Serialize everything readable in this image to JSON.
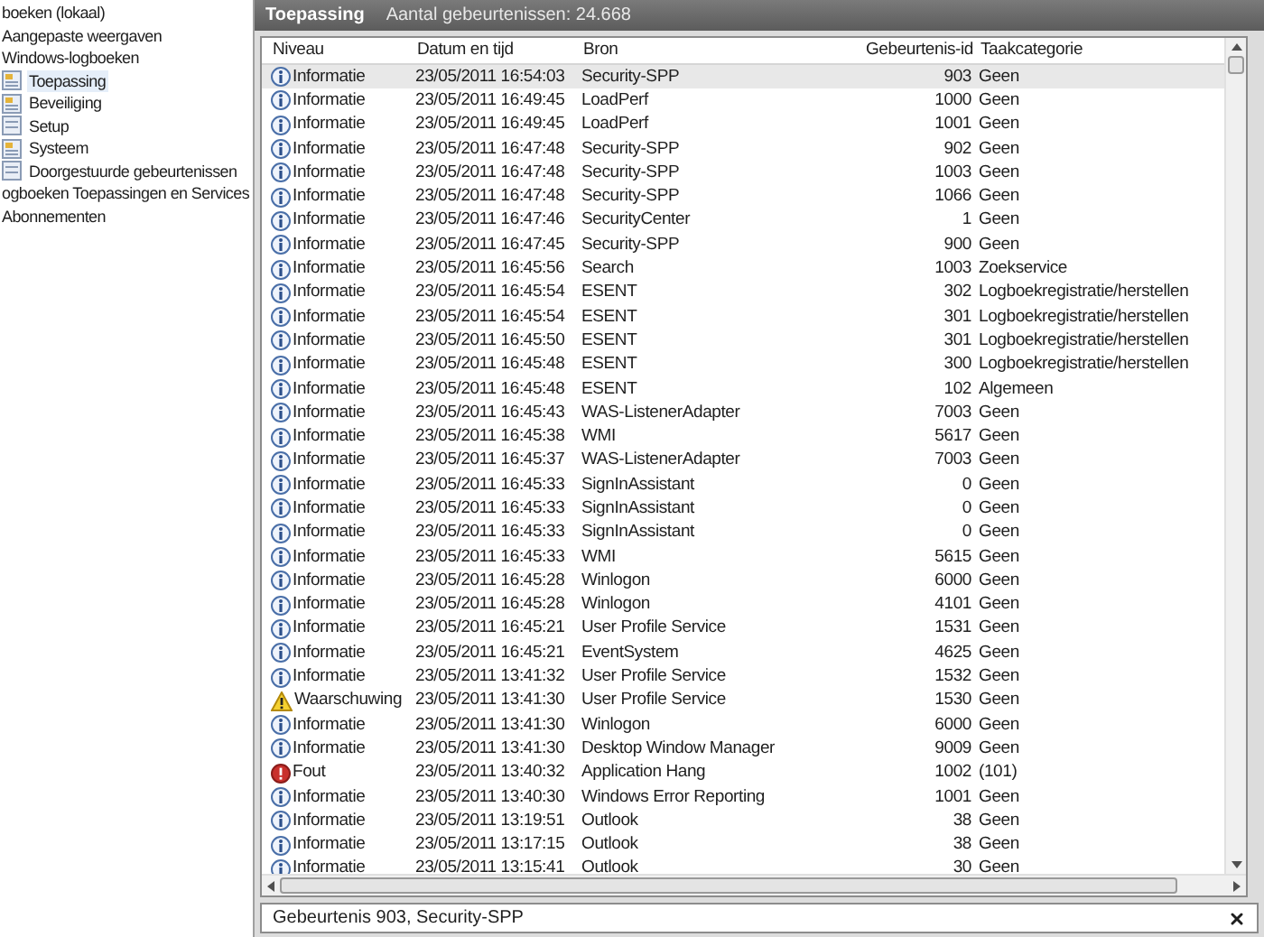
{
  "tree": [
    {
      "label": "boeken (lokaal)",
      "selected": false
    },
    {
      "label": "Aangepaste weergaven",
      "selected": false
    },
    {
      "label": "Windows-logboeken",
      "selected": false,
      "children": [
        {
          "label": "Toepassing",
          "selected": true,
          "kind": "log"
        },
        {
          "label": "Beveiliging",
          "selected": false,
          "kind": "log"
        },
        {
          "label": "Setup",
          "selected": false,
          "kind": "plain"
        },
        {
          "label": "Systeem",
          "selected": false,
          "kind": "log"
        },
        {
          "label": "Doorgestuurde gebeurtenissen",
          "selected": false,
          "kind": "plain"
        }
      ]
    },
    {
      "label": "ogboeken Toepassingen en Services",
      "selected": false
    },
    {
      "label": "Abonnementen",
      "selected": false
    }
  ],
  "panel": {
    "title": "Toepassing",
    "count": "Aantal gebeurtenissen: 24.668"
  },
  "table": {
    "columns": [
      "Niveau",
      "Datum en tijd",
      "Bron",
      "Gebeurtenis-id",
      "Taakcategorie"
    ],
    "rows": [
      {
        "kind": "info",
        "level": "Informatie",
        "date": "23/05/2011 16:54:03",
        "source": "Security-SPP",
        "id": "903",
        "category": "Geen",
        "selected": true
      },
      {
        "kind": "info",
        "level": "Informatie",
        "date": "23/05/2011 16:49:45",
        "source": "LoadPerf",
        "id": "1000",
        "category": "Geen",
        "selected": false
      },
      {
        "kind": "info",
        "level": "Informatie",
        "date": "23/05/2011 16:49:45",
        "source": "LoadPerf",
        "id": "1001",
        "category": "Geen",
        "selected": false
      },
      {
        "kind": "info",
        "level": "Informatie",
        "date": "23/05/2011 16:47:48",
        "source": "Security-SPP",
        "id": "902",
        "category": "Geen",
        "selected": false
      },
      {
        "kind": "info",
        "level": "Informatie",
        "date": "23/05/2011 16:47:48",
        "source": "Security-SPP",
        "id": "1003",
        "category": "Geen",
        "selected": false
      },
      {
        "kind": "info",
        "level": "Informatie",
        "date": "23/05/2011 16:47:48",
        "source": "Security-SPP",
        "id": "1066",
        "category": "Geen",
        "selected": false
      },
      {
        "kind": "info",
        "level": "Informatie",
        "date": "23/05/2011 16:47:46",
        "source": "SecurityCenter",
        "id": "1",
        "category": "Geen",
        "selected": false
      },
      {
        "kind": "info",
        "level": "Informatie",
        "date": "23/05/2011 16:47:45",
        "source": "Security-SPP",
        "id": "900",
        "category": "Geen",
        "selected": false
      },
      {
        "kind": "info",
        "level": "Informatie",
        "date": "23/05/2011 16:45:56",
        "source": "Search",
        "id": "1003",
        "category": "Zoekservice",
        "selected": false
      },
      {
        "kind": "info",
        "level": "Informatie",
        "date": "23/05/2011 16:45:54",
        "source": "ESENT",
        "id": "302",
        "category": "Logboekregistratie/herstellen",
        "selected": false
      },
      {
        "kind": "info",
        "level": "Informatie",
        "date": "23/05/2011 16:45:54",
        "source": "ESENT",
        "id": "301",
        "category": "Logboekregistratie/herstellen",
        "selected": false
      },
      {
        "kind": "info",
        "level": "Informatie",
        "date": "23/05/2011 16:45:50",
        "source": "ESENT",
        "id": "301",
        "category": "Logboekregistratie/herstellen",
        "selected": false
      },
      {
        "kind": "info",
        "level": "Informatie",
        "date": "23/05/2011 16:45:48",
        "source": "ESENT",
        "id": "300",
        "category": "Logboekregistratie/herstellen",
        "selected": false
      },
      {
        "kind": "info",
        "level": "Informatie",
        "date": "23/05/2011 16:45:48",
        "source": "ESENT",
        "id": "102",
        "category": "Algemeen",
        "selected": false
      },
      {
        "kind": "info",
        "level": "Informatie",
        "date": "23/05/2011 16:45:43",
        "source": "WAS-ListenerAdapter",
        "id": "7003",
        "category": "Geen",
        "selected": false
      },
      {
        "kind": "info",
        "level": "Informatie",
        "date": "23/05/2011 16:45:38",
        "source": "WMI",
        "id": "5617",
        "category": "Geen",
        "selected": false
      },
      {
        "kind": "info",
        "level": "Informatie",
        "date": "23/05/2011 16:45:37",
        "source": "WAS-ListenerAdapter",
        "id": "7003",
        "category": "Geen",
        "selected": false
      },
      {
        "kind": "info",
        "level": "Informatie",
        "date": "23/05/2011 16:45:33",
        "source": "SignInAssistant",
        "id": "0",
        "category": "Geen",
        "selected": false
      },
      {
        "kind": "info",
        "level": "Informatie",
        "date": "23/05/2011 16:45:33",
        "source": "SignInAssistant",
        "id": "0",
        "category": "Geen",
        "selected": false
      },
      {
        "kind": "info",
        "level": "Informatie",
        "date": "23/05/2011 16:45:33",
        "source": "SignInAssistant",
        "id": "0",
        "category": "Geen",
        "selected": false
      },
      {
        "kind": "info",
        "level": "Informatie",
        "date": "23/05/2011 16:45:33",
        "source": "WMI",
        "id": "5615",
        "category": "Geen",
        "selected": false
      },
      {
        "kind": "info",
        "level": "Informatie",
        "date": "23/05/2011 16:45:28",
        "source": "Winlogon",
        "id": "6000",
        "category": "Geen",
        "selected": false
      },
      {
        "kind": "info",
        "level": "Informatie",
        "date": "23/05/2011 16:45:28",
        "source": "Winlogon",
        "id": "4101",
        "category": "Geen",
        "selected": false
      },
      {
        "kind": "info",
        "level": "Informatie",
        "date": "23/05/2011 16:45:21",
        "source": "User Profile Service",
        "id": "1531",
        "category": "Geen",
        "selected": false
      },
      {
        "kind": "info",
        "level": "Informatie",
        "date": "23/05/2011 16:45:21",
        "source": "EventSystem",
        "id": "4625",
        "category": "Geen",
        "selected": false
      },
      {
        "kind": "info",
        "level": "Informatie",
        "date": "23/05/2011 13:41:32",
        "source": "User Profile Service",
        "id": "1532",
        "category": "Geen",
        "selected": false
      },
      {
        "kind": "warning",
        "level": "Waarschuwing",
        "date": "23/05/2011 13:41:30",
        "source": "User Profile Service",
        "id": "1530",
        "category": "Geen",
        "selected": false
      },
      {
        "kind": "info",
        "level": "Informatie",
        "date": "23/05/2011 13:41:30",
        "source": "Winlogon",
        "id": "6000",
        "category": "Geen",
        "selected": false
      },
      {
        "kind": "info",
        "level": "Informatie",
        "date": "23/05/2011 13:41:30",
        "source": "Desktop Window Manager",
        "id": "9009",
        "category": "Geen",
        "selected": false
      },
      {
        "kind": "error",
        "level": "Fout",
        "date": "23/05/2011 13:40:32",
        "source": "Application Hang",
        "id": "1002",
        "category": "(101)",
        "selected": false
      },
      {
        "kind": "info",
        "level": "Informatie",
        "date": "23/05/2011 13:40:30",
        "source": "Windows Error Reporting",
        "id": "1001",
        "category": "Geen",
        "selected": false
      },
      {
        "kind": "info",
        "level": "Informatie",
        "date": "23/05/2011 13:19:51",
        "source": "Outlook",
        "id": "38",
        "category": "Geen",
        "selected": false
      },
      {
        "kind": "info",
        "level": "Informatie",
        "date": "23/05/2011 13:17:15",
        "source": "Outlook",
        "id": "38",
        "category": "Geen",
        "selected": false
      },
      {
        "kind": "info",
        "level": "Informatie",
        "date": "23/05/2011 13:15:41",
        "source": "Outlook",
        "id": "30",
        "category": "Geen",
        "selected": false
      }
    ]
  },
  "details": {
    "title": "Gebeurtenis 903, Security-SPP"
  }
}
